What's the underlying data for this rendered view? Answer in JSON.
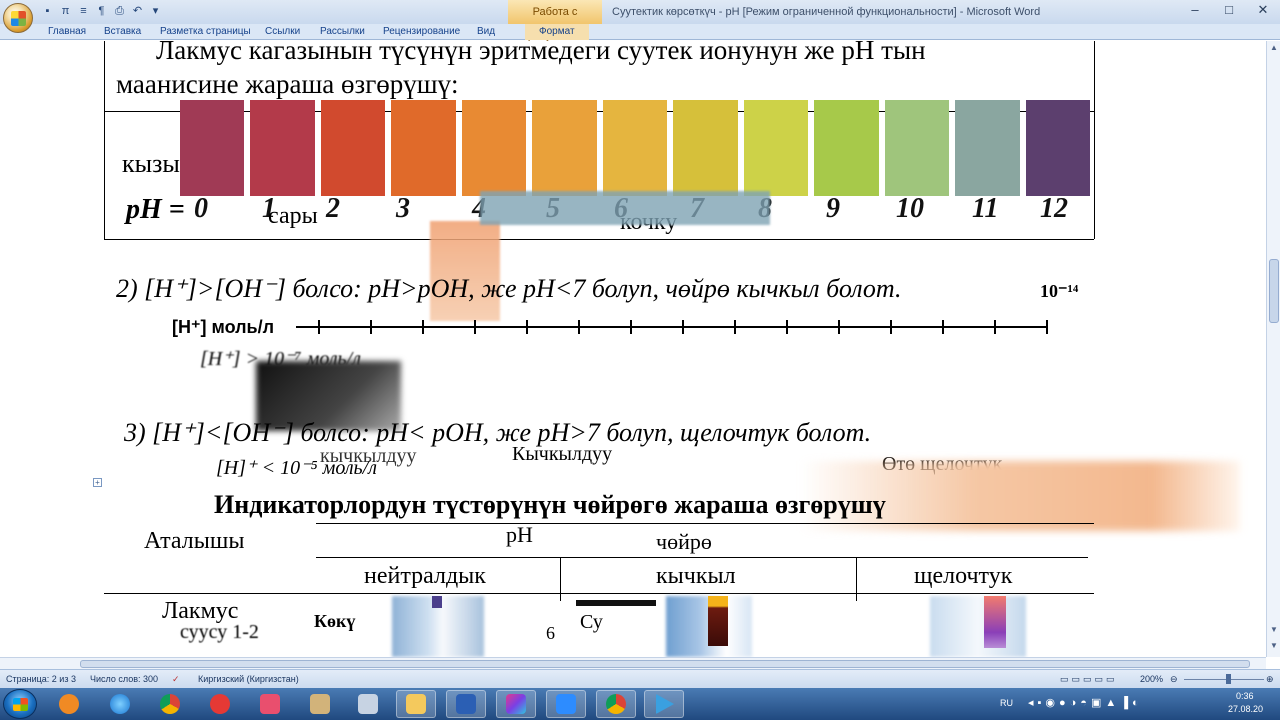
{
  "window": {
    "context_tab": "Работа с рисунками",
    "title": "Суутектик көрсөткүч - pH [Режим ограниченной функциональности] - Microsoft Word",
    "controls": [
      "–",
      "□",
      "✕"
    ]
  },
  "quick_access": [
    "save-icon",
    "pi-icon",
    "bullets-icon",
    "pilcrow-icon",
    "print-preview-icon",
    "undo-icon",
    "customize-icon"
  ],
  "ribbon": {
    "tabs": [
      "Главная",
      "Вставка",
      "Разметка страницы",
      "Ссылки",
      "Рассылки",
      "Рецензирование",
      "Вид"
    ],
    "context_tab": "Формат"
  },
  "document": {
    "line1": "Лакмус кагазынын түсүнүн эритмедеги суутек ионунун же pH тын",
    "line2": "маанисине жараша өзгөрүшү:",
    "frag_red": "кызы",
    "frag_yellow": "сары",
    "frag_acid": "кочку",
    "ph_label": "pH =",
    "ph_numbers": [
      "0",
      "1",
      "2",
      "3",
      "4",
      "5",
      "6",
      "7",
      "8",
      "9",
      "10",
      "11",
      "12"
    ],
    "ph_colors": [
      "#a03a55",
      "#b33a4a",
      "#d14a2e",
      "#e06a2a",
      "#e88a33",
      "#e9a13a",
      "#e5b53f",
      "#d6c03a",
      "#cdd248",
      "#a7c94a",
      "#9fc57c",
      "#8aa6a0",
      "#5c3f6e"
    ],
    "case2": "2) [H⁺]>[OH⁻] болсо: pH>pOH, же pH<7 болуп, чөйрө кычкыл болот.",
    "axis_end": "10⁻¹⁴",
    "axis_label": "[H⁺] моль/л",
    "axis_sub": "[H⁺] > 10⁻⁷ моль/л",
    "case3": "3) [H⁺]<[OH⁻] болсо: pH< pOH, же pH>7 болуп, щелочтук болот.",
    "frag_h": "[H]⁺ < 10⁻⁵ моль/л",
    "frag_acidity": "Кычкылдуу",
    "frag_acidity2": "кычкылдуу",
    "frag_strong_alk": "Өтө щелочтук",
    "table_title": "Индикаторлордун түстөрүнүн чөйрөгө жараша өзгөрүшү",
    "col_name": "Аталышы",
    "col_ph": "pH",
    "col_env": "чөйрө",
    "sub_neutral": "нейтралдык",
    "sub_acid": "кычкыл",
    "sub_alk": "щелочтук",
    "row1_name": "Лакмус",
    "row1_sub": "суусу 1-2",
    "row1_c1": "Көкү",
    "row1_c2": "6",
    "row1_c3": "Су"
  },
  "statusbar": {
    "page": "Страница: 2 из 3",
    "words": "Число слов: 300",
    "language": "Киргизский (Киргизстан)",
    "zoom": "200%"
  },
  "tray": {
    "lang": "RU",
    "time": "0:36",
    "date": "27.08.20"
  }
}
